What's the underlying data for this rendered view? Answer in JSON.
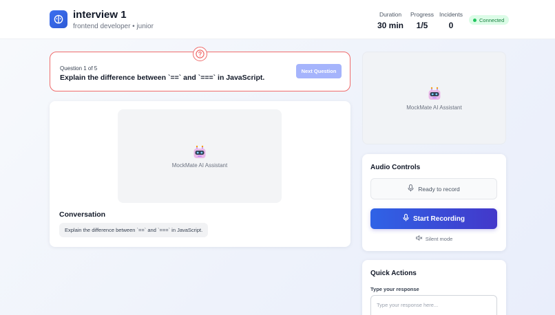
{
  "header": {
    "title": "interview 1",
    "subtitle": "frontend developer • junior",
    "stats": [
      {
        "label": "Duration",
        "value": "30 min"
      },
      {
        "label": "Progress",
        "value": "1/5"
      },
      {
        "label": "Incidents",
        "value": "0"
      }
    ],
    "status": "Connected",
    "status_color": "#22c55e"
  },
  "question": {
    "counter": "Question 1 of 5",
    "text": "Explain the difference between `==` and `===` in JavaScript.",
    "next_label": "Next Question",
    "accent_color": "#ef6b6b"
  },
  "main": {
    "assistant_label": "MockMate AI Assistant",
    "conversation_title": "Conversation",
    "messages": [
      "Explain the difference between `==` and `===` in JavaScript."
    ]
  },
  "side": {
    "assistant_label": "MockMate AI Assistant"
  },
  "audio": {
    "title": "Audio Controls",
    "ready_text": "Ready to record",
    "record_label": "Start Recording",
    "silent_text": "Silent mode"
  },
  "quick": {
    "title": "Quick Actions",
    "response_label": "Type your response",
    "response_placeholder": "Type your response here..."
  },
  "icons": {
    "app": "brain-icon",
    "question": "question-circle-icon",
    "robot": "robot-icon",
    "mic": "microphone-icon",
    "speaker": "speaker-muted-icon"
  }
}
